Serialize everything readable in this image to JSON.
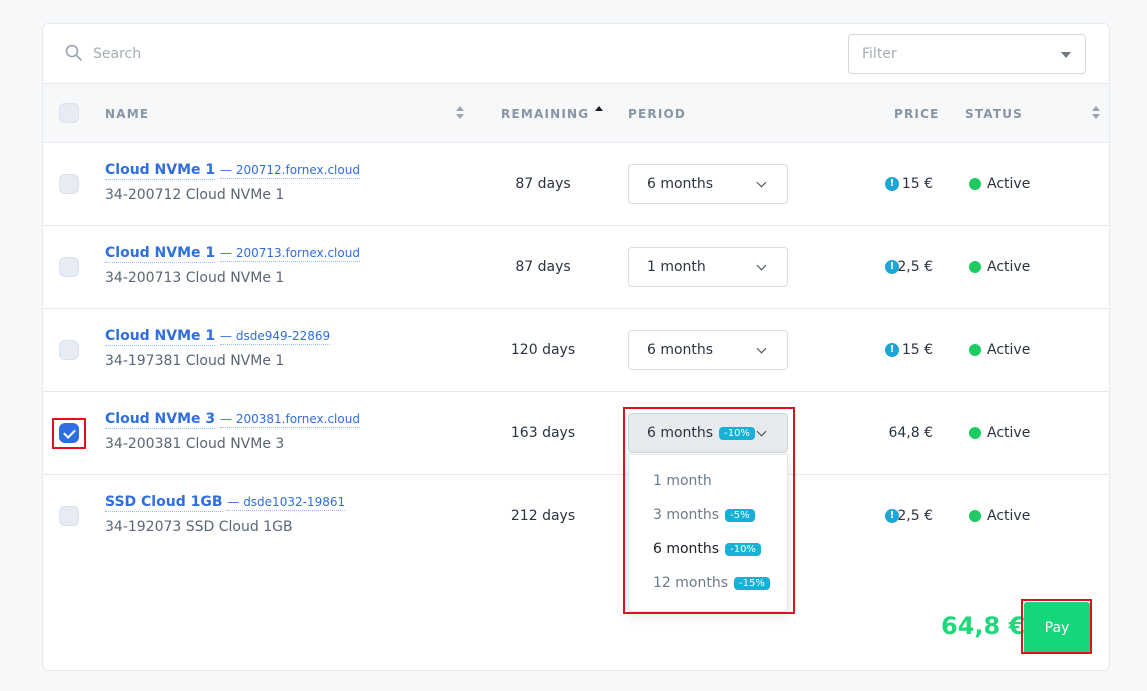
{
  "toolbar": {
    "search_placeholder": "Search",
    "filter_placeholder": "Filter"
  },
  "table": {
    "columns": {
      "name": "NAME",
      "remaining": "REMAINING",
      "period": "PERIOD",
      "price": "PRICE",
      "status": "STATUS"
    },
    "rows": [
      {
        "name": "Cloud NVMe 1",
        "host": "— 200712.fornex.cloud",
        "sub": "34-200712  Cloud NVMe 1",
        "remaining": "87 days",
        "period": "6 months",
        "price": "15 €",
        "warning": true,
        "status": "Active",
        "checked": false
      },
      {
        "name": "Cloud NVMe 1",
        "host": "— 200713.fornex.cloud",
        "sub": "34-200713  Cloud NVMe 1",
        "remaining": "87 days",
        "period": "1 month",
        "price": "2,5 €",
        "warning": true,
        "status": "Active",
        "checked": false
      },
      {
        "name": "Cloud NVMe 1",
        "host": "— dsde949-22869",
        "sub": "34-197381  Cloud NVMe 1",
        "remaining": "120 days",
        "period": "6 months",
        "price": "15 €",
        "warning": true,
        "status": "Active",
        "checked": false
      },
      {
        "name": "Cloud NVMe 3",
        "host": "— 200381.fornex.cloud",
        "sub": "34-200381  Cloud NVMe 3",
        "remaining": "163 days",
        "period": "6 months",
        "period_badge": "-10%",
        "price": "64,8 €",
        "warning": false,
        "status": "Active",
        "checked": true
      },
      {
        "name": "SSD Cloud 1GB",
        "host": "— dsde1032-19861",
        "sub": "34-192073  SSD Cloud 1GB",
        "remaining": "212 days",
        "period": "",
        "price": "2,5 €",
        "warning": true,
        "status": "Active",
        "checked": false
      }
    ]
  },
  "period_dropdown": {
    "options": [
      {
        "label": "1 month",
        "badge": ""
      },
      {
        "label": "3 months",
        "badge": "-5%"
      },
      {
        "label": "6 months",
        "badge": "-10%"
      },
      {
        "label": "12 months",
        "badge": "-15%"
      }
    ],
    "selected": "6 months"
  },
  "footer": {
    "total": "64,8 €",
    "pay_label": "Pay"
  },
  "colors": {
    "accent": "#2f6ee0",
    "success": "#1ccc62",
    "pay": "#14d77c",
    "badge": "#17b0d6",
    "warning": "#1ea6d6"
  }
}
